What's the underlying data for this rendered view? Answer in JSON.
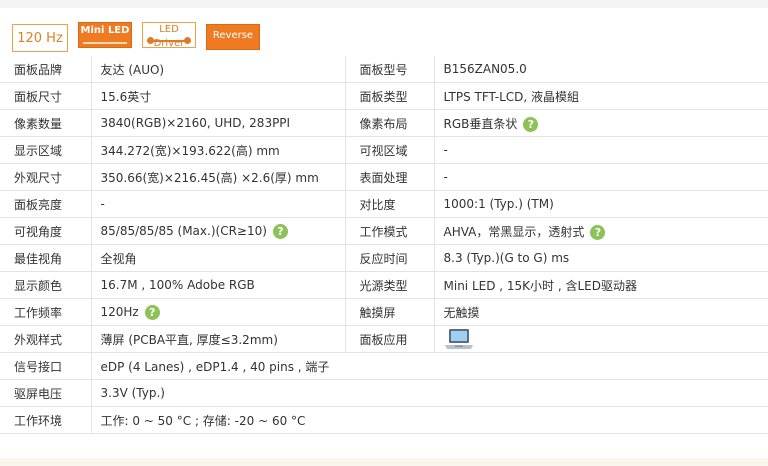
{
  "badges": {
    "refresh": "120 Hz",
    "mini_led": "Mini LED",
    "led_driver": "LED Driver",
    "reverse": "Reverse"
  },
  "rows": [
    {
      "l1": "面板品牌",
      "v1": "友达 (AUO)",
      "l2": "面板型号",
      "v2": "B156ZAN05.0"
    },
    {
      "l1": "面板尺寸",
      "v1": "15.6英寸",
      "l2": "面板类型",
      "v2": "LTPS TFT-LCD, 液晶模組"
    },
    {
      "l1": "像素数量",
      "v1": "3840(RGB)×2160, UHD, 283PPI",
      "l2": "像素布局",
      "v2": "RGB垂直条状"
    },
    {
      "l1": "显示区域",
      "v1": "344.272(宽)×193.622(高) mm",
      "l2": "可视区域",
      "v2": "-"
    },
    {
      "l1": "外观尺寸",
      "v1": "350.66(宽)×216.45(高) ×2.6(厚) mm",
      "l2": "表面处理",
      "v2": "-"
    },
    {
      "l1": "面板亮度",
      "v1": "-",
      "l2": "对比度",
      "v2": "1000:1 (Typ.) (TM)"
    },
    {
      "l1": "可视角度",
      "v1": "85/85/85/85 (Max.)(CR≥10)",
      "l2": "工作模式",
      "v2": "AHVA，常黑显示，透射式"
    },
    {
      "l1": "最佳视角",
      "v1": "全视角",
      "l2": "反应时间",
      "v2": "8.3 (Typ.)(G to G) ms"
    },
    {
      "l1": "显示颜色",
      "v1": "16.7M , 100% Adobe RGB",
      "l2": "光源类型",
      "v2": "Mini LED , 15K小时 , 含LED驱动器"
    },
    {
      "l1": "工作频率",
      "v1": "120Hz",
      "l2": "触摸屏",
      "v2": "无触摸"
    },
    {
      "l1": "外观样式",
      "v1": "薄屏 (PCBA平直, 厚度≤3.2mm)",
      "l2": "面板应用",
      "v2": ""
    },
    {
      "l1": "信号接口",
      "v1": "eDP (4 Lanes) , eDP1.4 , 40 pins , 端子"
    },
    {
      "l1": "驱屏电压",
      "v1": "3.3V (Typ.)"
    },
    {
      "l1": "工作环境",
      "v1": "工作: 0 ~ 50 °C ; 存储: -20 ~ 60 °C"
    }
  ],
  "help_glyph": "?",
  "icons": {
    "help": "help-circle-icon",
    "application": "laptop-icon"
  },
  "colors": {
    "accent": "#ee7b22",
    "help": "#8cc257"
  }
}
